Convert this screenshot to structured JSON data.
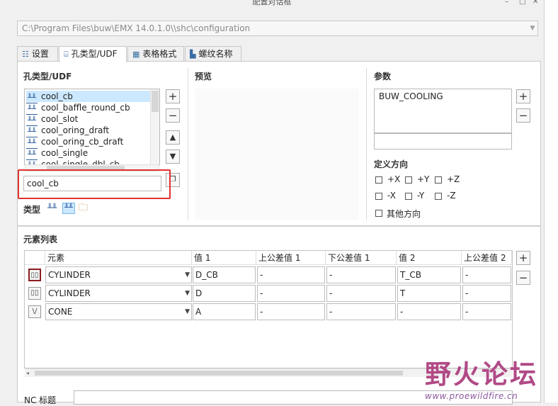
{
  "window": {
    "title": "配置对话框",
    "minimize": "–",
    "maximize": "□",
    "close": "✕"
  },
  "path": {
    "value": "C:\\Program Files\\buw\\EMX 14.0.1.0\\\\shc\\configuration"
  },
  "tabs": [
    {
      "label": "设置",
      "icon": "settings-icon"
    },
    {
      "label": "孔类型/UDF",
      "icon": "hole-icon"
    },
    {
      "label": "表格格式",
      "icon": "table-icon"
    },
    {
      "label": "螺纹名称",
      "icon": "thread-icon"
    }
  ],
  "hole_section": {
    "title": "孔类型/UDF",
    "items": [
      "cool_cb",
      "cool_baffle_round_cb",
      "cool_slot",
      "cool_oring_draft",
      "cool_oring_cb_draft",
      "cool_single",
      "cool_single_dbl_cb"
    ],
    "selected": "cool_cb",
    "input_value": "cool_cb",
    "type_label": "类型",
    "add_label": "+",
    "remove_label": "−",
    "up_label": "▲",
    "down_label": "▼"
  },
  "preview": {
    "title": "预览"
  },
  "params": {
    "title": "参数",
    "items": [
      "BUW_COOLING"
    ],
    "add_label": "+",
    "remove_label": "−",
    "direction_title": "定义方向",
    "directions": [
      "+X",
      "+Y",
      "+Z",
      "-X",
      "-Y",
      "-Z"
    ],
    "other_direction": "其他方向"
  },
  "elements": {
    "title": "元素列表",
    "columns": [
      "元素",
      "值 1",
      "上公差值 1",
      "下公差值 1",
      "值 2",
      "上公差值 2"
    ],
    "rows": [
      {
        "element": "CYLINDER",
        "v1": "D_CB",
        "ut1": "-",
        "lt1": "-",
        "v2": "T_CB",
        "ut2": "-"
      },
      {
        "element": "CYLINDER",
        "v1": "D",
        "ut1": "-",
        "lt1": "-",
        "v2": "T",
        "ut2": "-"
      },
      {
        "element": "CONE",
        "v1": "A",
        "ut1": "-",
        "lt1": "-",
        "v2": "-",
        "ut2": "-"
      }
    ],
    "add_label": "+",
    "remove_label": "−"
  },
  "nc": {
    "label": "NC 标题"
  },
  "watermark": {
    "text": "野火论坛",
    "url": "www.proewildfire.cn"
  }
}
